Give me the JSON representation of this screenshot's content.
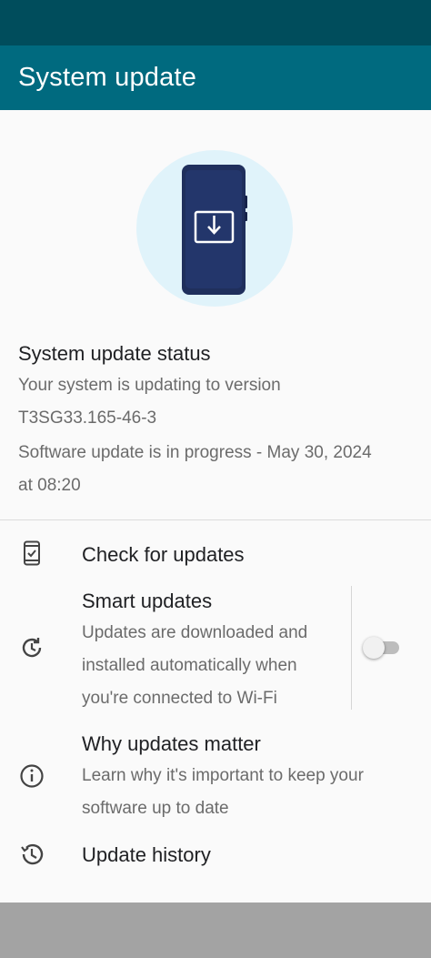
{
  "app": {
    "title": "System update"
  },
  "status": {
    "title": "System update status",
    "version_line1": "Your system is updating to version",
    "version_line2": "T3SG33.165-46-3",
    "progress_line1": "Software update is in progress - May 30, 2024",
    "progress_line2": "at 08:20"
  },
  "menu": {
    "check_updates": {
      "title": "Check for updates",
      "icon": "phone-check-icon"
    },
    "smart_updates": {
      "title": "Smart updates",
      "sub1": "Updates are downloaded and",
      "sub2": "installed automatically when",
      "sub3": "you're connected to Wi-Fi",
      "icon": "auto-update-icon",
      "toggle_on": false
    },
    "why_updates": {
      "title": "Why updates matter",
      "sub1": "Learn why it's important to keep your",
      "sub2": "software up to date",
      "icon": "info-icon"
    },
    "history": {
      "title": "Update history",
      "icon": "history-icon"
    }
  },
  "colors": {
    "status_bar": "#004d5c",
    "app_bar": "#006a7f",
    "hero_bg": "#e0f3fa",
    "phone_body": "#1f2f5c",
    "nav_bar": "#a3a3a3"
  }
}
